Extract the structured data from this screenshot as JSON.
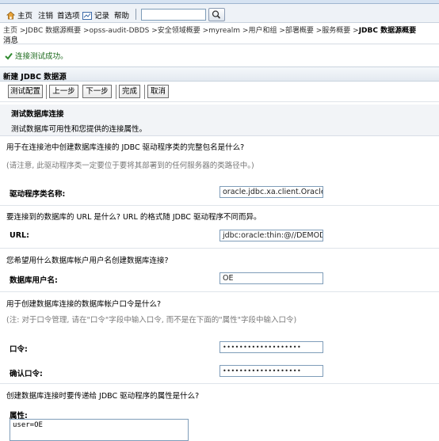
{
  "toolbar": {
    "home": "主页",
    "logout": "注销",
    "preferences": "首选项",
    "record": "记录",
    "help": "帮助",
    "search_value": ""
  },
  "breadcrumb": "主页 >JDBC 数据源概要 >opss-audit-DBDS >安全领域概要 >myrealm >用户和组 >部署概要 >服务概要 >",
  "breadcrumb_last": "JDBC 数据源概要",
  "messages": {
    "header": "消息",
    "success": "连接测试成功。"
  },
  "section_title": "新建 JDBC 数据源",
  "buttons": {
    "test_config": "测试配置",
    "back": "上一步",
    "next": "下一步",
    "finish": "完成",
    "cancel": "取消"
  },
  "subsection": {
    "title": "测试数据库连接",
    "description": "测试数据库可用性和您提供的连接属性。"
  },
  "form": {
    "driver_question": "用于在连接池中创建数据库连接的 JDBC 驱动程序类的完整包名是什么?",
    "driver_note": "(请注意, 此驱动程序类一定要位于要将其部署到的任何服务器的类路径中。)",
    "driver_label": "驱动程序类名称:",
    "driver_value": "oracle.jdbc.xa.client.OracleXA",
    "url_question": "要连接到的数据库的 URL 是什么? URL 的格式随 JDBC 驱动程序不同而异。",
    "url_label": "URL:",
    "url_value": "jdbc:oracle:thin:@//DEMODB",
    "user_question": "您希望用什么数据库帐户用户名创建数据库连接?",
    "user_label": "数据库用户名:",
    "user_value": "OE",
    "password_question": "用于创建数据库连接的数据库帐户口令是什么?",
    "password_note": "(注: 对于口令管理, 请在\"口令\"字段中输入口令, 而不是在下面的\"属性\"字段中输入口令)",
    "password_label": "口令:",
    "password_value": "•••••••••••••••••••",
    "confirm_label": "确认口令:",
    "confirm_value": "•••••••••••••••••••",
    "properties_question": "创建数据库连接时要传递给 JDBC 驱动程序的属性是什么?",
    "properties_label": "属性:",
    "properties_value": "user=OE"
  },
  "colors": {
    "success_green": "#1d6a1d",
    "field_border": "#7f9db9"
  }
}
